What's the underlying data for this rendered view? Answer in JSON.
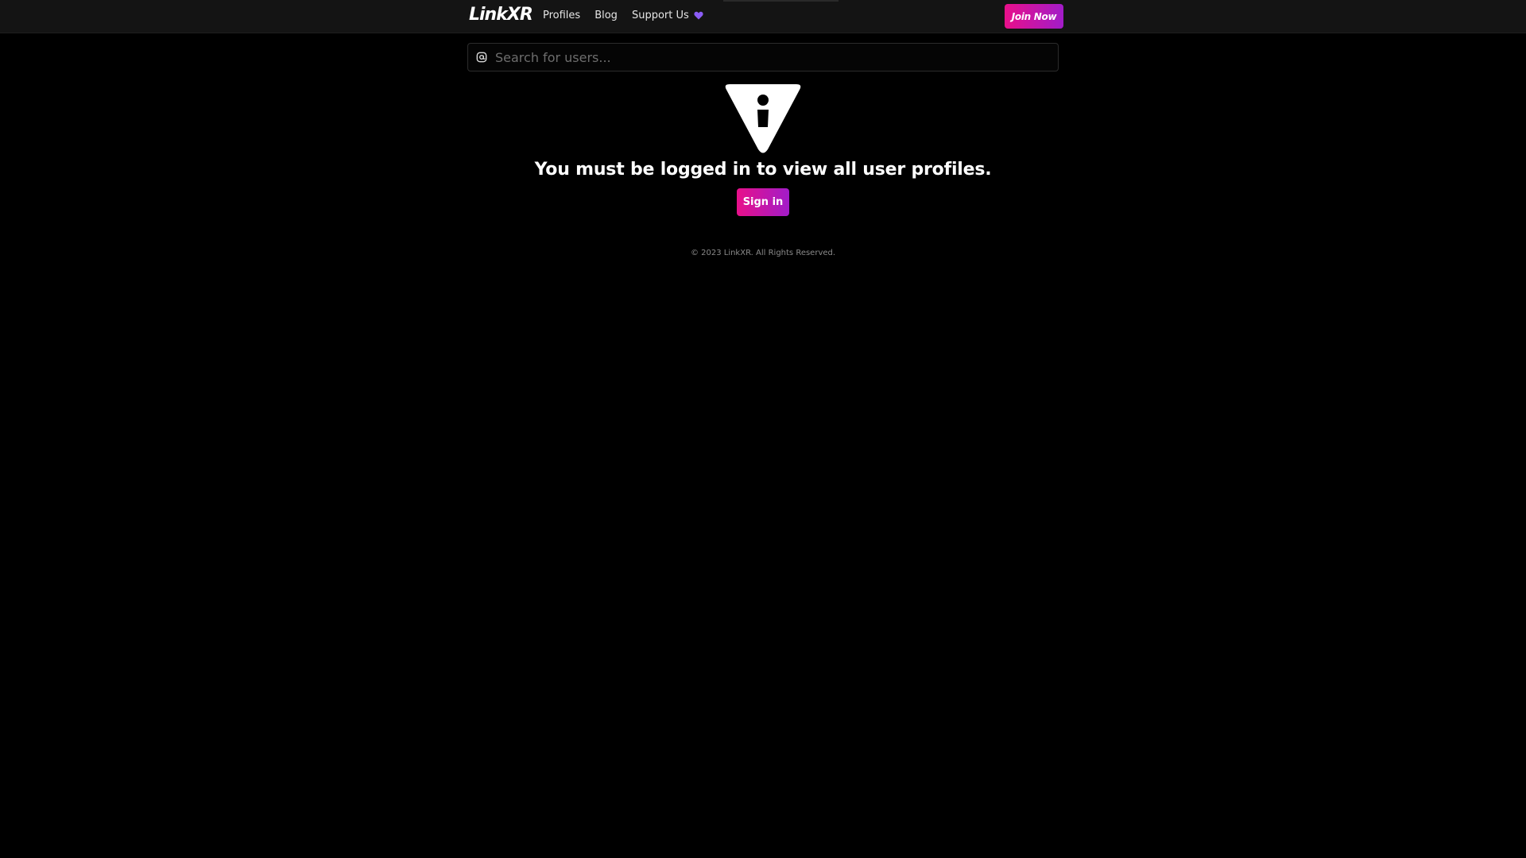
{
  "navbar": {
    "logo": "LinkXR",
    "links": [
      {
        "label": "Profiles"
      },
      {
        "label": "Blog"
      },
      {
        "label": "Support Us",
        "icon": "heart-icon"
      }
    ],
    "join_label": "Join Now"
  },
  "search": {
    "icon": "at-sign-icon",
    "placeholder": "Search for users...",
    "value": ""
  },
  "notice": {
    "icon": "warning-info-icon",
    "message": "You must be logged in to view all user profiles.",
    "button_label": "Sign in"
  },
  "footer": {
    "text": "© 2023 LinkXR. All Rights Reserved."
  },
  "colors": {
    "background": "#000000",
    "navbar": "#141414",
    "accent_pink": "#e8108a",
    "accent_purple": "#a21cc8",
    "heart": "#8b5cf6"
  }
}
